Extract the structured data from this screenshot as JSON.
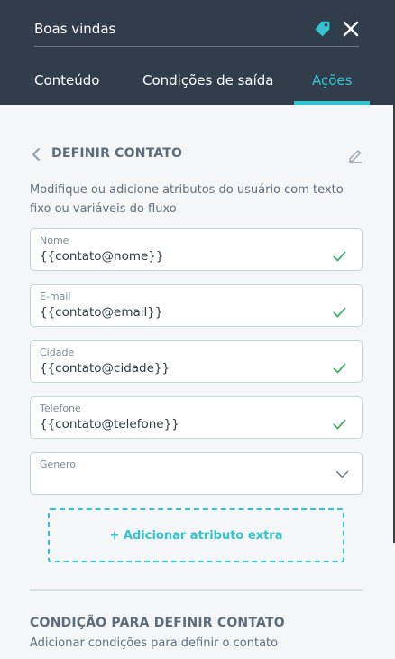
{
  "header": {
    "title": "Boas vindas",
    "tabs": [
      {
        "label": "Conteúdo",
        "active": false
      },
      {
        "label": "Condições de saída",
        "active": false
      },
      {
        "label": "Ações",
        "active": true
      }
    ]
  },
  "section": {
    "title": "DEFINIR CONTATO",
    "description": "Modifique ou adicione atributos do usuário com texto fixo ou variáveis do fluxo"
  },
  "fields": [
    {
      "label": "Nome",
      "value": "{{contato@nome}}",
      "icon": "check-icon"
    },
    {
      "label": "E-mail",
      "value": "{{contato@email}}",
      "icon": "check-icon"
    },
    {
      "label": "Cidade",
      "value": "{{contato@cidade}}",
      "icon": "check-icon"
    },
    {
      "label": "Telefone",
      "value": "{{contato@telefone}}",
      "icon": "check-icon"
    },
    {
      "label": "Genero",
      "value": "",
      "icon": "chevron-down-icon"
    }
  ],
  "add_button_label": "+ Adicionar atributo extra",
  "condition": {
    "title": "CONDIÇÃO PARA DEFINIR CONTATO",
    "subtitle": "Adicionar condições para definir o contato"
  },
  "colors": {
    "header_bg": "#323d4b",
    "accent": "#33c4d1",
    "check": "#3bb06b",
    "body_bg": "#f4f6f7"
  }
}
